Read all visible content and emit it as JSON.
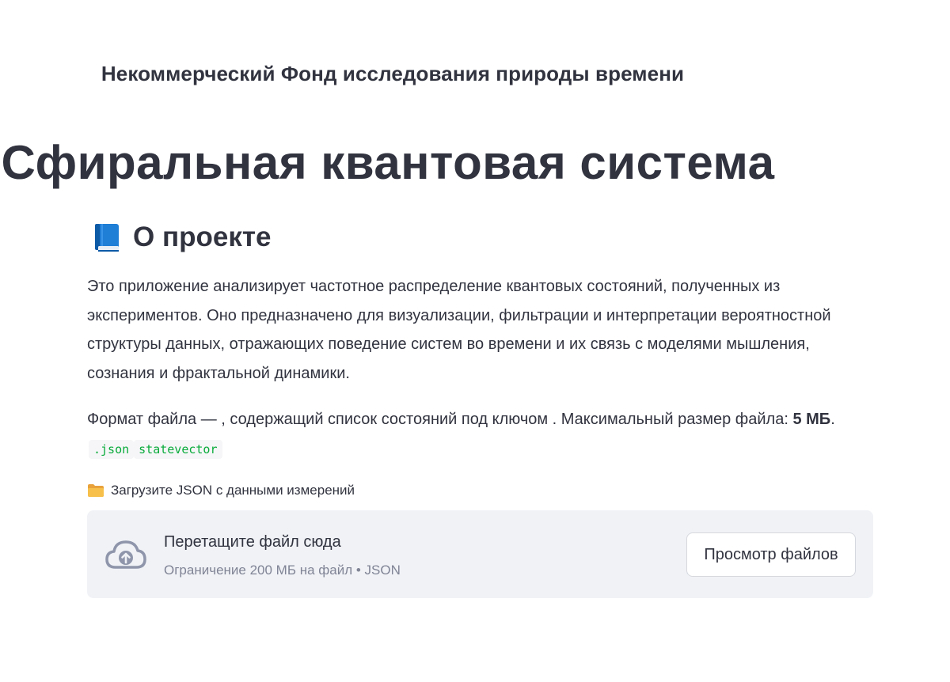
{
  "header": {
    "organization": "Некоммерческий Фонд исследования природы времени"
  },
  "page": {
    "title": "Сфиральная квантовая система"
  },
  "about": {
    "icon": "blue-book-icon",
    "heading": "О проекте",
    "paragraph1": "Это приложение анализирует частотное распределение квантовых состояний, полученных из экспериментов. Оно предназначено для визуализации, фильтрации и интерпретации вероятностной структуры данных, отражающих поведение систем во времени и их связь с моделями мышления, сознания и фрактальной динамики.",
    "paragraph2_text": "Формат файла — , содержащий список состояний под ключом . Максимальный размер файла: ",
    "paragraph2_bold": "5 МБ",
    "paragraph2_end": ".",
    "code_format": ".json",
    "code_key": "statevector"
  },
  "uploader": {
    "label_icon": "folder-icon",
    "label": "Загрузите JSON с данными измерений",
    "dropzone_icon": "cloud-upload-icon",
    "dropzone_title": "Перетащите файл сюда",
    "dropzone_limit": "Ограничение 200 МБ на файл • JSON",
    "browse_button": "Просмотр файлов"
  },
  "colors": {
    "text": "#31333f",
    "muted": "#808495",
    "code_green": "#09ab3b",
    "dropzone_bg": "#f0f2f6",
    "book_blue": "#1f7ed6"
  }
}
